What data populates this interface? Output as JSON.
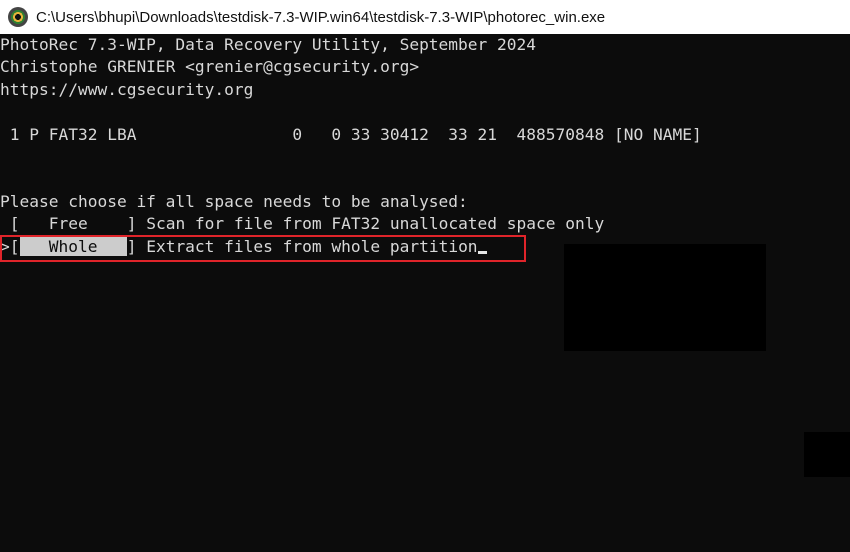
{
  "window": {
    "title": "C:\\Users\\bhupi\\Downloads\\testdisk-7.3-WIP.win64\\testdisk-7.3-WIP\\photorec_win.exe",
    "icon": "photorec-app-icon"
  },
  "console": {
    "header_line1": "PhotoRec 7.3-WIP, Data Recovery Utility, September 2024",
    "header_line2": "Christophe GRENIER <grenier@cgsecurity.org>",
    "header_line3": "https://www.cgsecurity.org",
    "partition_line": " 1 P FAT32 LBA                0   0 33 30412  33 21  488570848 [NO NAME]",
    "prompt": "Please choose if all space needs to be analysed:",
    "options": [
      {
        "prefix": " [",
        "label": "   Free    ",
        "suffix": "] ",
        "description": "Scan for file from FAT32 unallocated space only",
        "selected": false
      },
      {
        "prefix": ">[",
        "label": "   Whole   ",
        "suffix": "] ",
        "description": "Extract files from whole partition",
        "selected": true
      }
    ],
    "colors": {
      "background": "#0c0c0c",
      "text": "#d8d8d8",
      "selection_bg": "#cccccc",
      "highlight_border": "#e0242a"
    }
  }
}
